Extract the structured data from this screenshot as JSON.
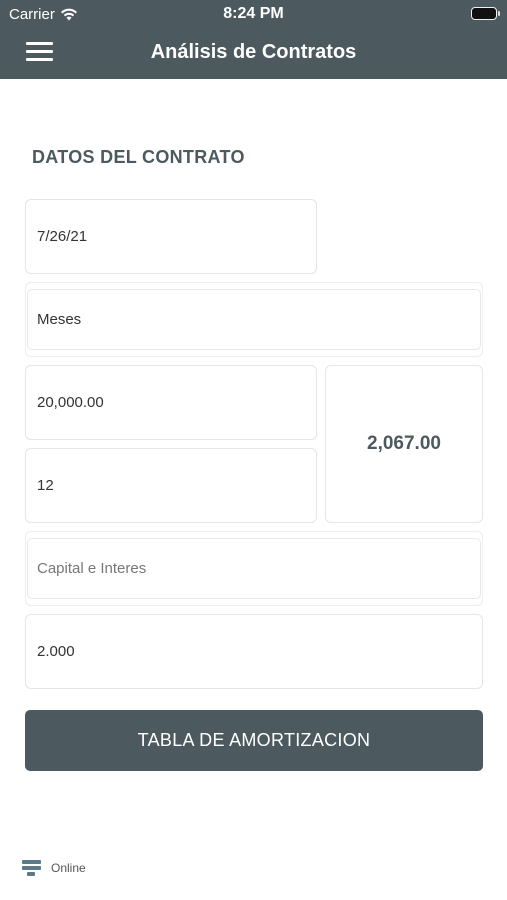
{
  "status_bar": {
    "carrier": "Carrier",
    "time": "8:24 PM"
  },
  "nav": {
    "title": "Análisis de Contratos"
  },
  "section": {
    "title": "DATOS DEL CONTRATO"
  },
  "form": {
    "date_value": "7/26/21",
    "period_value": "Meses",
    "amount_value": "20,000.00",
    "term_value": "12",
    "payment_result": "2,067.00",
    "amortization_type": "Capital e Interes",
    "rate_value": "2.000"
  },
  "button": {
    "label": "TABLA DE AMORTIZACION"
  },
  "footer": {
    "connection_status": "Online"
  },
  "colors": {
    "primary": "#4c5a60",
    "border": "#e6e6e6"
  }
}
